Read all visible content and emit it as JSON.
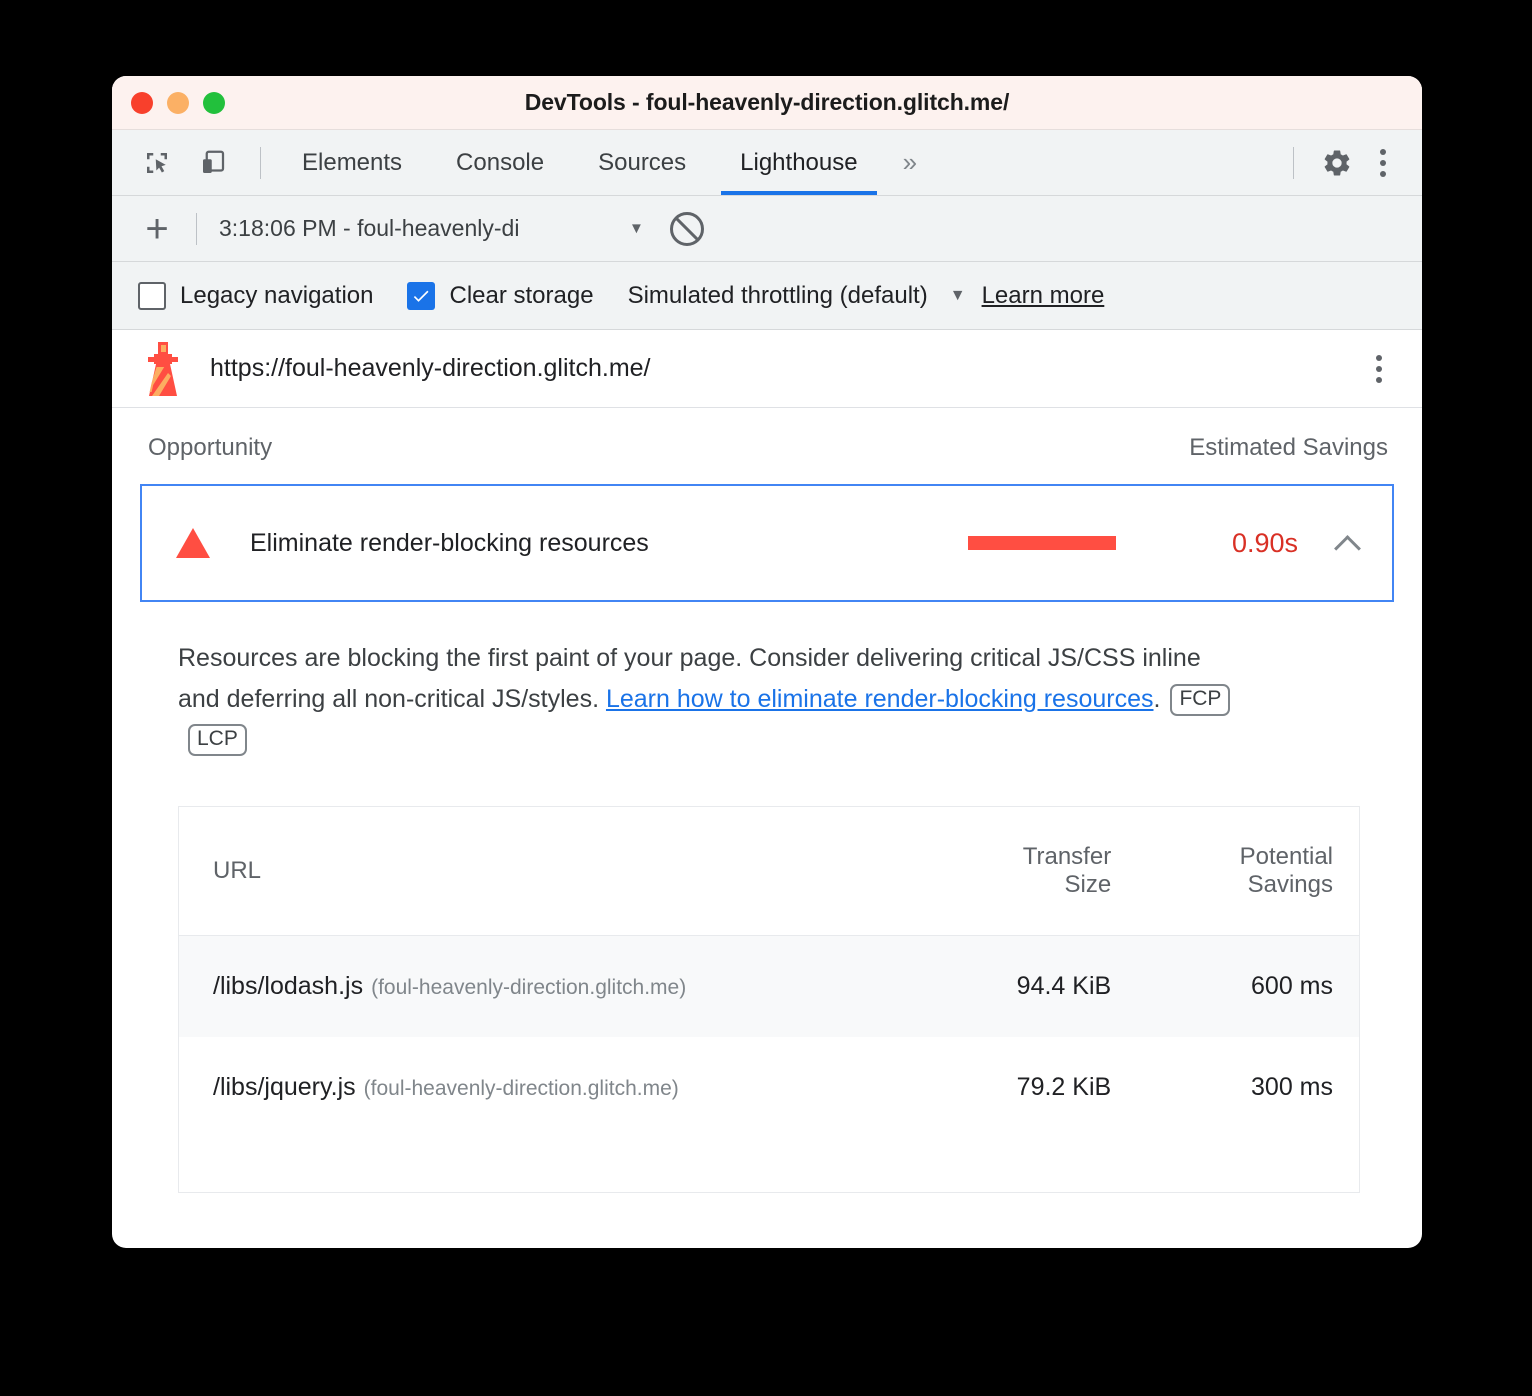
{
  "window": {
    "title": "DevTools - foul-heavenly-direction.glitch.me/",
    "traffic_lights": [
      "close",
      "minimize",
      "maximize"
    ],
    "colors": {
      "close": "#F8402C",
      "minimize": "#FBB065",
      "maximize": "#22C03C",
      "titlebar_bg": "#FDF2EF"
    }
  },
  "tabbar": {
    "inspect_icon": "inspect-element-icon",
    "device_icon": "device-toolbar-icon",
    "tabs": [
      {
        "label": "Elements",
        "active": false
      },
      {
        "label": "Console",
        "active": false
      },
      {
        "label": "Sources",
        "active": false
      },
      {
        "label": "Lighthouse",
        "active": true
      }
    ],
    "more_tabs": "»",
    "settings_icon": "gear-icon",
    "menu_icon": "kebab-menu-icon",
    "active_underline_color": "#1A73E8"
  },
  "runbar": {
    "add_label": "+",
    "report_select": "3:18:06 PM - foul-heavenly-di",
    "caret": "▼",
    "clear_icon": "no-entry-icon"
  },
  "options": {
    "legacy_navigation": {
      "label": "Legacy navigation",
      "checked": false
    },
    "clear_storage": {
      "label": "Clear storage",
      "checked": true
    },
    "throttling": {
      "label": "Simulated throttling (default)",
      "caret": "▼"
    },
    "learn_more": "Learn more",
    "checkbox_accent": "#1A73E8"
  },
  "report": {
    "icon": "lighthouse-icon",
    "url": "https://foul-heavenly-direction.glitch.me/",
    "menu_icon": "kebab-menu-icon"
  },
  "columns": {
    "opportunity": "Opportunity",
    "estimated_savings": "Estimated Savings"
  },
  "opportunity": {
    "severity_icon": "warning-triangle-icon",
    "severity_color": "#FF4E42",
    "title": "Eliminate render-blocking resources",
    "savings_value": "0.90s",
    "savings_color": "#D93025",
    "bar_color": "#FF4E42",
    "bar_fraction": 1.0,
    "expanded": true,
    "collapse_icon": "chevron-up-icon",
    "focus_border_color": "#4285F4",
    "description_part1": "Resources are blocking the first paint of your page. Consider delivering critical JS/CSS inline and deferring all non-critical JS/styles. ",
    "description_link": "Learn how to eliminate render-blocking resources",
    "description_part2": ".",
    "metric_badges": [
      "FCP",
      "LCP"
    ]
  },
  "table": {
    "headers": {
      "url": "URL",
      "transfer_size_line1": "Transfer",
      "transfer_size_line2": "Size",
      "potential_savings_line1": "Potential",
      "potential_savings_line2": "Savings"
    },
    "rows": [
      {
        "path": "/libs/lodash.js",
        "host": "(foul-heavenly-direction.glitch.me)",
        "transfer_size": "94.4 KiB",
        "potential_savings": "600 ms"
      },
      {
        "path": "/libs/jquery.js",
        "host": "(foul-heavenly-direction.glitch.me)",
        "transfer_size": "79.2 KiB",
        "potential_savings": "300 ms"
      }
    ]
  }
}
